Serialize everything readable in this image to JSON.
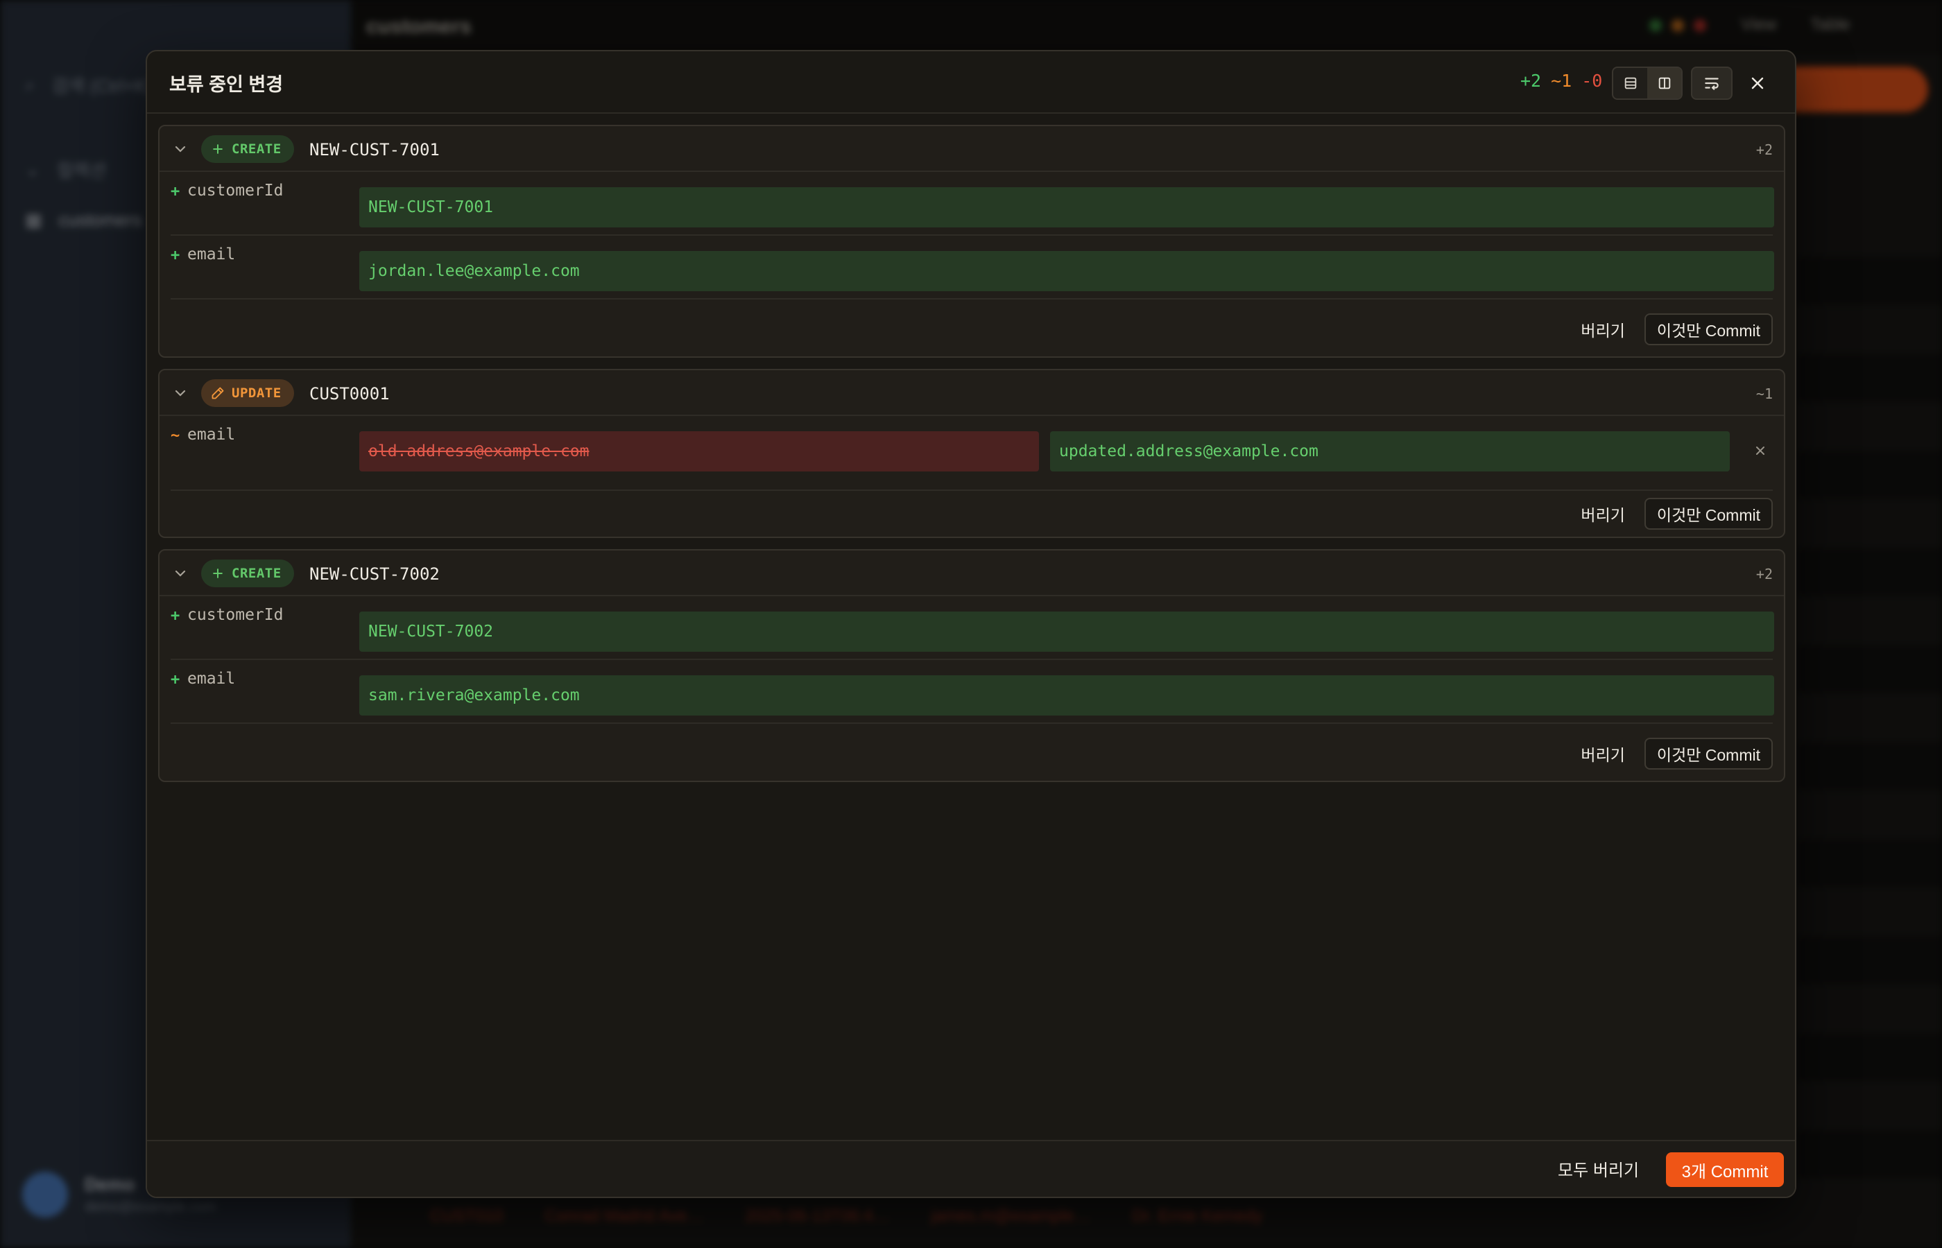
{
  "background": {
    "sidebar": {
      "search_text": "검색 (Ctrl+K)",
      "section_label": "컬렉션",
      "active_item": "customers",
      "user_name": "Demo",
      "user_sub": "demo@example.com"
    },
    "topbar": {
      "title": "customers",
      "view_label": "View",
      "mode_label": "Table"
    },
    "table_bottom_row": [
      "CUST010",
      "Conrad Madrid Ave…",
      "2025-06-13T06:4…",
      "james.m@example…",
      "Dr. Ernie Kemedy"
    ]
  },
  "modal": {
    "title": "보류 중인 변경",
    "stats": {
      "added": "+2",
      "modified": "~1",
      "deleted": "-0"
    },
    "cards": [
      {
        "kind": "CREATE",
        "record_id": "NEW-CUST-7001",
        "count": "+2",
        "fields": [
          {
            "mark": "+",
            "name": "customerId",
            "new_value": "NEW-CUST-7001"
          },
          {
            "mark": "+",
            "name": "email",
            "new_value": "jordan.lee@example.com"
          }
        ],
        "discard_label": "버리기",
        "commit_label": "이것만 Commit"
      },
      {
        "kind": "UPDATE",
        "record_id": "CUST0001",
        "count": "~1",
        "fields": [
          {
            "mark": "~",
            "name": "email",
            "old_value": "old.address@example.com",
            "new_value": "updated.address@example.com"
          }
        ],
        "discard_label": "버리기",
        "commit_label": "이것만 Commit"
      },
      {
        "kind": "CREATE",
        "record_id": "NEW-CUST-7002",
        "count": "+2",
        "fields": [
          {
            "mark": "+",
            "name": "customerId",
            "new_value": "NEW-CUST-7002"
          },
          {
            "mark": "+",
            "name": "email",
            "new_value": "sam.rivera@example.com"
          }
        ],
        "discard_label": "버리기",
        "commit_label": "이것만 Commit"
      }
    ],
    "footer": {
      "discard_all_label": "모두 버리기",
      "commit_all_label": "3개 Commit"
    }
  },
  "colors": {
    "accent": "#ef5516",
    "added": "#4cc86a",
    "modified": "#f08b2c",
    "deleted": "#e2503f"
  },
  "icons": {
    "collapse": "chevron-down-icon",
    "create": "plus-icon",
    "update": "pencil-icon",
    "unified_view": "rows-icon",
    "split_view": "columns-icon",
    "wrap": "wrap-text-icon",
    "close": "close-icon",
    "revert": "close-icon"
  }
}
